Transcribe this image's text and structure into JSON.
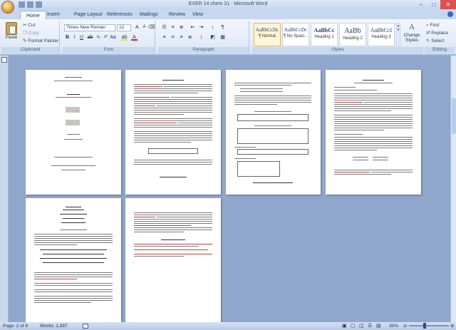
{
  "window": {
    "title": "EXER 14 chem 31 - Microsoft Word"
  },
  "tabs": [
    "Home",
    "Insert",
    "Page Layout",
    "References",
    "Mailings",
    "Review",
    "View"
  ],
  "clipboard": {
    "paste": "Paste",
    "cut": "Cut",
    "copy": "Copy",
    "format_painter": "Format Painter",
    "label": "Clipboard"
  },
  "font": {
    "family": "Times New Roman",
    "size": "12",
    "label": "Font",
    "bold": "B",
    "italic": "I",
    "underline": "U"
  },
  "paragraph": {
    "label": "Paragraph"
  },
  "styles": {
    "items": [
      {
        "sample": "AaBbCcDc",
        "name": "¶ Normal"
      },
      {
        "sample": "AaBbCcDc",
        "name": "¶ No Spaci..."
      },
      {
        "sample": "AaBbCc",
        "name": "Heading 1"
      },
      {
        "sample": "AaBb",
        "name": "Heading 2"
      },
      {
        "sample": "AaBbCcI",
        "name": "Heading 3"
      }
    ],
    "change_styles": "Change Styles",
    "label": "Styles"
  },
  "editing": {
    "find": "Find",
    "replace": "Replace",
    "select": "Select",
    "label": "Editing"
  },
  "status": {
    "page": "Page: 2 of 6",
    "words": "Words: 1,397",
    "zoom": "30%"
  },
  "colors": {
    "ribbon_bg": "#dbe6f5",
    "doc_bg": "#8fa7cc",
    "accent": "#e2b75a"
  }
}
